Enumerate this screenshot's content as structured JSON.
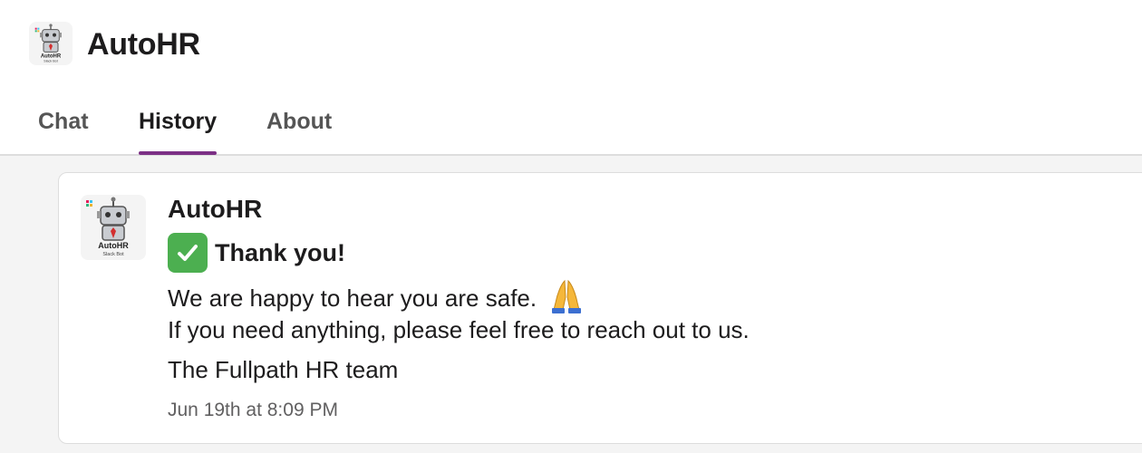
{
  "header": {
    "app_name": "AutoHR",
    "avatar_icon": "robot-icon",
    "avatar_caption": "AutoHR",
    "avatar_subcaption": "Slack Bot"
  },
  "tabs": [
    {
      "label": "Chat",
      "active": false
    },
    {
      "label": "History",
      "active": true
    },
    {
      "label": "About",
      "active": false
    }
  ],
  "message": {
    "sender": "AutoHR",
    "avatar_icon": "robot-icon",
    "avatar_caption": "AutoHR",
    "avatar_subcaption": "Slack Bot",
    "heading_icon": "check-mark-icon",
    "heading": "Thank you!",
    "lines": [
      "We are happy to hear you are safe.",
      "If you need anything, please feel free to reach out to us.",
      "The Fullpath HR team"
    ],
    "line1_emoji": "folded-hands-icon",
    "timestamp": "Jun 19th at 8:09 PM"
  },
  "colors": {
    "accent": "#7c3085",
    "text": "#1d1c1d",
    "muted": "#616061",
    "check_green": "#4caf50",
    "background": "#f4f4f4"
  }
}
